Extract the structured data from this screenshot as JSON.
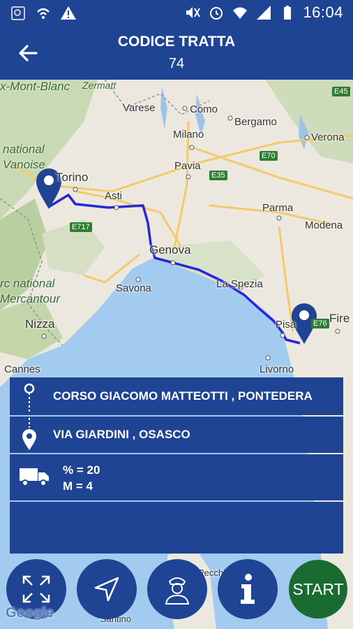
{
  "status_bar": {
    "time": "16:04",
    "icons": [
      "screenshot-icon",
      "wifi-call-icon",
      "warning-icon",
      "mute-icon",
      "alarm-icon",
      "wifi-icon",
      "signal-icon",
      "battery-icon"
    ]
  },
  "header": {
    "title": "CODICE TRATTA",
    "subtitle": "74"
  },
  "map": {
    "cities": [
      "Como",
      "Varese",
      "Bergamo",
      "Milano",
      "Verona",
      "Torino",
      "Pavia",
      "Asti",
      "Parma",
      "Modena",
      "Genova",
      "Savona",
      "La Spezia",
      "Nizza",
      "Pisa",
      "Fire",
      "Cannes",
      "Livorno",
      "Pecchi",
      "Santino"
    ],
    "parks": [
      "x-Mont-Blanc",
      "Zermatt",
      "national",
      "Vanoise",
      "rc national",
      "Mercantour"
    ],
    "highways": [
      "E45",
      "E70",
      "E35",
      "E717",
      "E76"
    ],
    "attribution": "Google"
  },
  "route": {
    "from": "CORSO GIACOMO MATTEOTTI  , PONTEDERA",
    "to": "VIA GIARDINI  , OSASCO",
    "percent": "% = 20",
    "m": "M = 4"
  },
  "buttons": {
    "start": "START"
  },
  "colors": {
    "primary": "#1e4493",
    "start": "#1a6b32",
    "route": "#2727d8"
  }
}
